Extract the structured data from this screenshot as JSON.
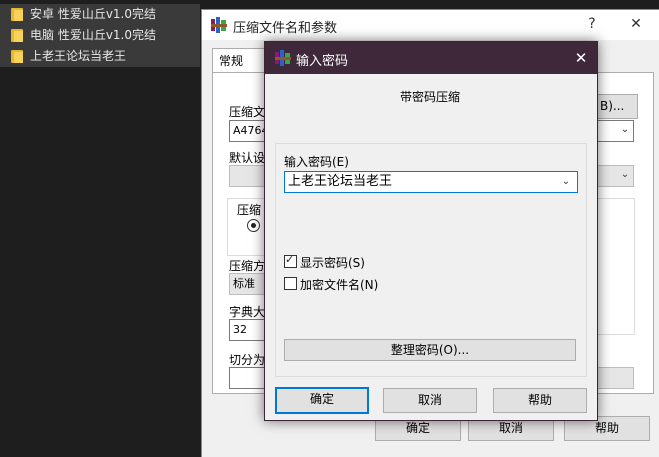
{
  "explorer": {
    "items": [
      {
        "name": "安卓 性爱山丘v1.0完结"
      },
      {
        "name": "电脑 性爱山丘v1.0完结"
      },
      {
        "name": "上老王论坛当老王"
      }
    ]
  },
  "bg_dialog": {
    "title": "压缩文件名和参数",
    "help_btn": "?",
    "close_btn": "✕",
    "tab_general": "常规",
    "label_archive_name": "压缩文",
    "archive_name_value": "A4764",
    "browse_btn": "B)...",
    "label_default_profile": "默认设",
    "label_archive_format": "压缩",
    "label_method": "压缩方",
    "method_value": "标准",
    "label_dict": "字典大",
    "dict_value": "32",
    "label_split": "切分为",
    "ok": "确定",
    "cancel": "取消",
    "help": "帮助"
  },
  "pw_dialog": {
    "title": "输入密码",
    "close_btn": "✕",
    "heading": "带密码压缩",
    "label_enter": "输入密码(E)",
    "password_value": "上老王论坛当老王",
    "show_password": "显示密码(S)",
    "show_password_checked": true,
    "encrypt_names": "加密文件名(N)",
    "encrypt_names_checked": false,
    "organize_btn": "整理密码(O)...",
    "ok": "确定",
    "cancel": "取消",
    "help": "帮助"
  },
  "colors": {
    "modal_title_bg": "#3e2839",
    "focus_blue": "#0078d7",
    "explorer_bg": "#1e1e1e"
  }
}
